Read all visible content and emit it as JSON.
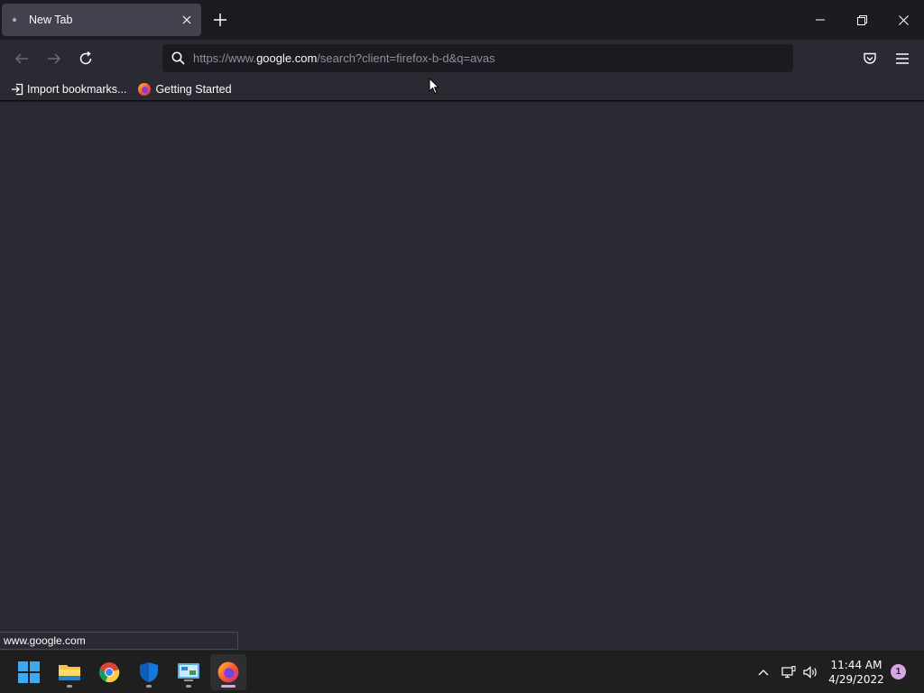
{
  "tab": {
    "title": "New Tab"
  },
  "urlbar": {
    "prefix": "https://www.",
    "host": "google.com",
    "path": "/search?client=firefox-b-d&q=avas"
  },
  "bookmarks": [
    {
      "label": "Import bookmarks..."
    },
    {
      "label": "Getting Started"
    }
  ],
  "status": {
    "text": "www.google.com"
  },
  "taskbar": {
    "clock_time": "11:44 AM",
    "clock_date": "4/29/2022",
    "notification_count": "1"
  },
  "colors": {
    "accent": "#e0a4e6",
    "chrome_bg": "#1c1b22",
    "toolbar_bg": "#2b2a33"
  }
}
